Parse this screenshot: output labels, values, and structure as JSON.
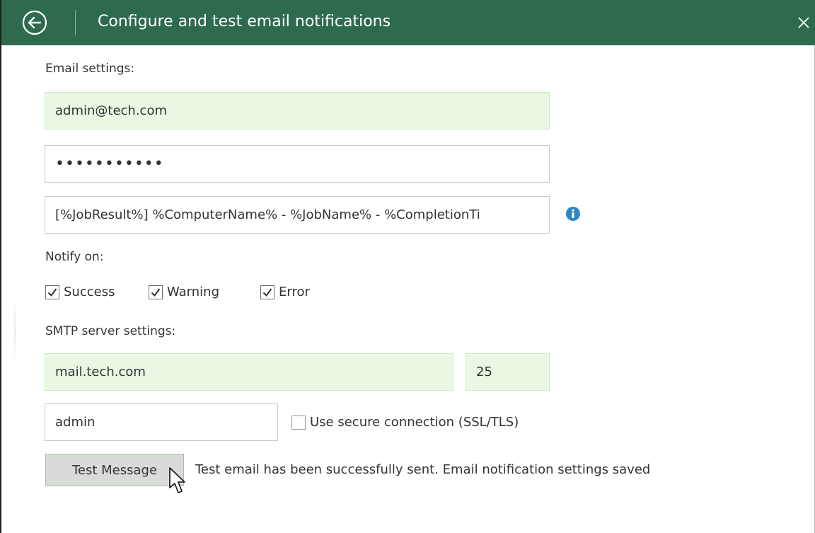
{
  "window": {
    "title": "Configure and test email notifications",
    "accent_color": "#2e6b4e",
    "back_icon": "back-arrow-circle-icon",
    "close_icon": "close-icon"
  },
  "email_settings": {
    "label": "Email settings:",
    "email_value": "admin@tech.com",
    "password_value": "•••••••••••",
    "subject_value": "[%JobResult%] %ComputerName% - %JobName% - %CompletionTi",
    "info_icon": "info-icon"
  },
  "notify": {
    "label": "Notify on:",
    "options": [
      {
        "label": "Success",
        "checked": true
      },
      {
        "label": "Warning",
        "checked": true
      },
      {
        "label": "Error",
        "checked": true
      }
    ]
  },
  "smtp": {
    "label": "SMTP server settings:",
    "server_value": "mail.tech.com",
    "port_value": "25",
    "username_value": "admin",
    "secure_label": "Use secure connection (SSL/TLS)",
    "secure_checked": false
  },
  "actions": {
    "test_button_label": "Test Message",
    "status_text": "Test email has been successfully sent. Email notification settings saved"
  }
}
